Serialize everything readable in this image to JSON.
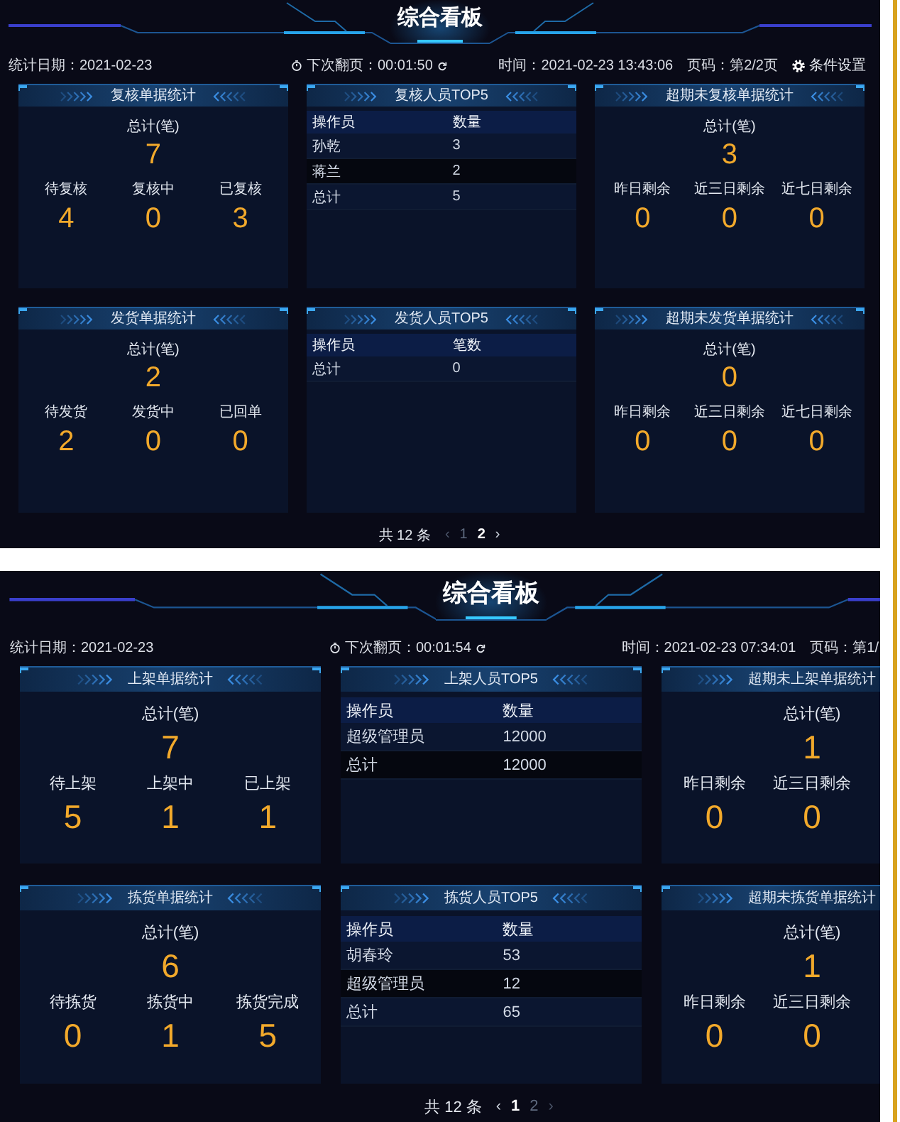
{
  "screens": [
    {
      "title": "综合看板",
      "info": {
        "date": "统计日期：2021-02-23",
        "countdown": "下次翻页：00:01:50",
        "time": "时间：2021-02-23 13:43:06",
        "page": "页码：第2/2页",
        "settings": "条件设置"
      },
      "panels": [
        {
          "kind": "stats",
          "title": "复核单据统计",
          "total_label": "总计(笔)",
          "total": "7",
          "items": [
            {
              "label": "待复核",
              "value": "4"
            },
            {
              "label": "复核中",
              "value": "0"
            },
            {
              "label": "已复核",
              "value": "3"
            }
          ]
        },
        {
          "kind": "table",
          "title": "复核人员TOP5",
          "columns": [
            "操作员",
            "数量"
          ],
          "rows": [
            [
              "孙乾",
              "3"
            ],
            [
              "蒋兰",
              "2"
            ],
            [
              "总计",
              "5"
            ]
          ]
        },
        {
          "kind": "stats",
          "title": "超期未复核单据统计",
          "total_label": "总计(笔)",
          "total": "3",
          "items": [
            {
              "label": "昨日剩余",
              "value": "0"
            },
            {
              "label": "近三日剩余",
              "value": "0"
            },
            {
              "label": "近七日剩余",
              "value": "0"
            }
          ]
        },
        {
          "kind": "stats",
          "title": "发货单据统计",
          "total_label": "总计(笔)",
          "total": "2",
          "items": [
            {
              "label": "待发货",
              "value": "2"
            },
            {
              "label": "发货中",
              "value": "0"
            },
            {
              "label": "已回单",
              "value": "0"
            }
          ]
        },
        {
          "kind": "table",
          "title": "发货人员TOP5",
          "columns": [
            "操作员",
            "笔数"
          ],
          "rows": [
            [
              "总计",
              "0"
            ]
          ]
        },
        {
          "kind": "stats",
          "title": "超期未发货单据统计",
          "total_label": "总计(笔)",
          "total": "0",
          "items": [
            {
              "label": "昨日剩余",
              "value": "0"
            },
            {
              "label": "近三日剩余",
              "value": "0"
            },
            {
              "label": "近七日剩余",
              "value": "0"
            }
          ]
        }
      ],
      "pagination": {
        "total": "共 12 条",
        "prev": {
          "label": "‹",
          "disabled": true
        },
        "pages": [
          {
            "label": "1",
            "selected": false
          },
          {
            "label": "2",
            "selected": true
          }
        ],
        "next": {
          "label": "›",
          "disabled": false
        }
      }
    },
    {
      "title": "综合看板",
      "info": {
        "date": "统计日期：2021-02-23",
        "countdown": "下次翻页：00:01:54",
        "time": "时间：2021-02-23 07:34:01",
        "page": "页码：第1/"
      },
      "panels": [
        {
          "kind": "stats",
          "title": "上架单据统计",
          "total_label": "总计(笔)",
          "total": "7",
          "items": [
            {
              "label": "待上架",
              "value": "5"
            },
            {
              "label": "上架中",
              "value": "1"
            },
            {
              "label": "已上架",
              "value": "1"
            }
          ]
        },
        {
          "kind": "table",
          "title": "上架人员TOP5",
          "columns": [
            "操作员",
            "数量"
          ],
          "rows": [
            [
              "超级管理员",
              "12000"
            ],
            [
              "总计",
              "12000"
            ]
          ]
        },
        {
          "kind": "stats",
          "title": "超期未上架单据统计",
          "total_label": "总计(笔)",
          "total": "1",
          "items": [
            {
              "label": "昨日剩余",
              "value": "0"
            },
            {
              "label": "近三日剩余",
              "value": "0"
            }
          ]
        },
        {
          "kind": "stats",
          "title": "拣货单据统计",
          "total_label": "总计(笔)",
          "total": "6",
          "items": [
            {
              "label": "待拣货",
              "value": "0"
            },
            {
              "label": "拣货中",
              "value": "1"
            },
            {
              "label": "拣货完成",
              "value": "5"
            }
          ]
        },
        {
          "kind": "table",
          "title": "拣货人员TOP5",
          "columns": [
            "操作员",
            "数量"
          ],
          "rows": [
            [
              "胡春玲",
              "53"
            ],
            [
              "超级管理员",
              "12"
            ],
            [
              "总计",
              "65"
            ]
          ]
        },
        {
          "kind": "stats",
          "title": "超期未拣货单据统计",
          "total_label": "总计(笔)",
          "total": "1",
          "items": [
            {
              "label": "昨日剩余",
              "value": "0"
            },
            {
              "label": "近三日剩余",
              "value": "0"
            }
          ]
        }
      ],
      "pagination": {
        "total": "共 12 条",
        "prev": {
          "label": "‹",
          "disabled": false
        },
        "pages": [
          {
            "label": "1",
            "selected": true
          },
          {
            "label": "2",
            "selected": false
          }
        ],
        "next": {
          "label": "›",
          "disabled": true
        }
      }
    }
  ]
}
